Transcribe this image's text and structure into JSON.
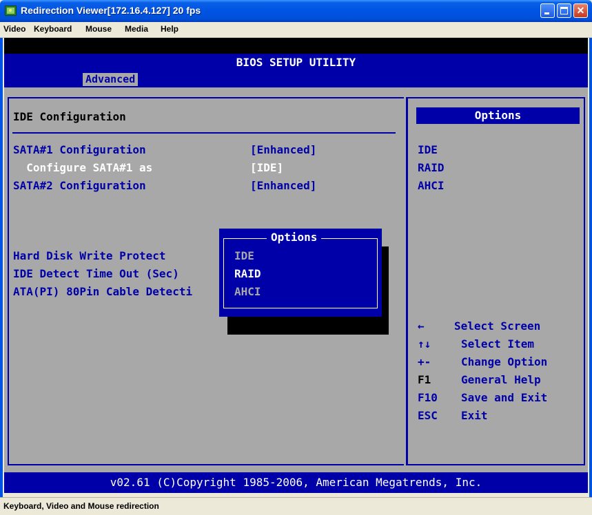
{
  "window": {
    "title": "Redirection Viewer[172.16.4.127]  20 fps",
    "minimize_label": "",
    "maximize_label": "",
    "close_label": "✕"
  },
  "menu": {
    "video": "Video",
    "keyboard": "Keyboard",
    "mouse": "Mouse",
    "media": "Media",
    "help": "Help"
  },
  "bios": {
    "header": "BIOS SETUP UTILITY",
    "tab": "Advanced",
    "section_title": "IDE Configuration",
    "rows": [
      {
        "label": "SATA#1 Configuration",
        "value": "[Enhanced]"
      },
      {
        "label": "  Configure SATA#1 as",
        "value": "[IDE]"
      },
      {
        "label": "SATA#2 Configuration",
        "value": "[Enhanced]"
      },
      {
        "label": "Hard Disk Write Protect",
        "value": ""
      },
      {
        "label": "IDE Detect Time Out (Sec)",
        "value": ""
      },
      {
        "label": "ATA(PI) 80Pin Cable Detecti",
        "value": ""
      }
    ],
    "options_header": "Options",
    "options": [
      "IDE",
      "RAID",
      "AHCI"
    ],
    "popup": {
      "title": "Options",
      "items": [
        "IDE",
        "RAID",
        "AHCI"
      ],
      "selected": "RAID"
    },
    "keys": [
      {
        "key": "←",
        "action": "Select Screen"
      },
      {
        "key": "↑↓",
        "action": "Select Item"
      },
      {
        "key": "+-",
        "action": "Change Option"
      },
      {
        "key": "F1",
        "action": "General Help"
      },
      {
        "key": "F10",
        "action": "Save and Exit"
      },
      {
        "key": "ESC",
        "action": "Exit"
      }
    ],
    "footer": "v02.61 (C)Copyright 1985-2006, American Megatrends, Inc."
  },
  "status": "Keyboard, Video and Mouse redirection",
  "colors": {
    "bios_blue": "#0000a8",
    "bios_gray": "#a8a8a8",
    "xp_title_blue": "#0054e3"
  }
}
